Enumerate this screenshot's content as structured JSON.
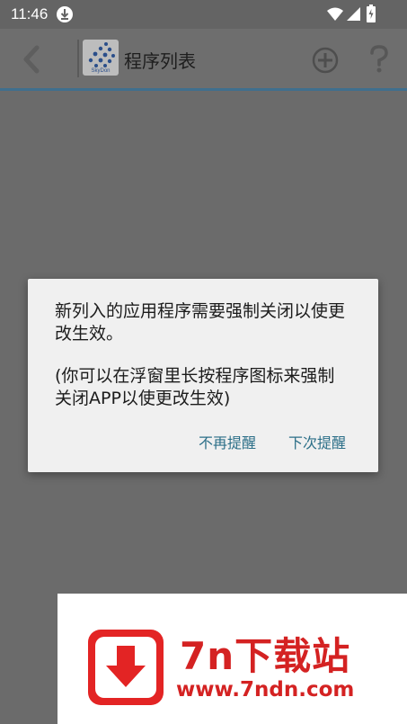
{
  "status_bar": {
    "time": "11:46",
    "icons": [
      "download-icon",
      "wifi-icon",
      "signal-icon",
      "battery-icon"
    ]
  },
  "toolbar": {
    "title": "程序列表",
    "logo_text": "SkyDon",
    "icons": [
      "back-icon",
      "app-logo",
      "add-icon",
      "help-icon"
    ]
  },
  "dialog": {
    "message_line1": "新列入的应用程序需要强制关闭以使更改生效。",
    "message_line2": "(你可以在浮窗里长按程序图标来强制关闭APP以使更改生效)",
    "button_no_remind": "不再提醒",
    "button_remind_next": "下次提醒"
  },
  "watermark": {
    "title": "7n下载站",
    "url": "www.7ndn.com"
  },
  "colors": {
    "background": "#6b6b6b",
    "dialog": "#f0f0f0",
    "button_text": "#2c6f88",
    "toolbar_accent": "#3f6f8e",
    "watermark_red": "#d42222"
  }
}
